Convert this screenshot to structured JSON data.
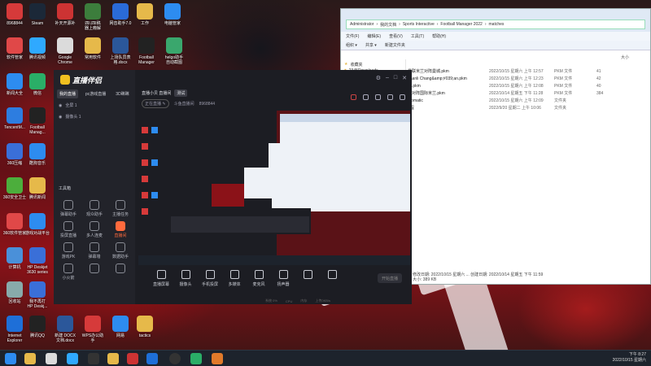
{
  "desktop": {
    "icons": [
      {
        "label": "8968844",
        "color": "#d63a3a"
      },
      {
        "label": "Steam",
        "color": "#1b2838"
      },
      {
        "label": "补天开源补",
        "color": "#c33"
      },
      {
        "label": "四I.四I稿\n器上瘾解",
        "color": "#3c7d3c"
      },
      {
        "label": "网音助手7.0",
        "color": "#2a6bd8"
      },
      {
        "label": "工作",
        "color": "#e6b94a"
      },
      {
        "label": "电脑管家",
        "color": "#2d8cf0"
      },
      {
        "label": "软件管家",
        "color": "#e04848"
      },
      {
        "label": "腾讯视频",
        "color": "#2fa9ff"
      },
      {
        "label": "Google\nChrome",
        "color": "#dbdbdb"
      },
      {
        "label": "常用软件",
        "color": "#e6b94a"
      },
      {
        "label": "上场队员表\n格.docx",
        "color": "#2b579a"
      },
      {
        "label": "Football\nManager",
        "color": "#222"
      },
      {
        "label": "helgo助手\n自动截图",
        "color": "#3aa76d"
      },
      {
        "label": "新闻大全",
        "color": "#2d8cf0"
      },
      {
        "label": "微信",
        "color": "#2aae67"
      },
      {
        "label": "TencentM...",
        "color": "#2d7de0"
      },
      {
        "label": "Football\nManag...",
        "color": "#222"
      },
      {
        "label": "360压缩",
        "color": "#3a6fd8"
      },
      {
        "label": "酷狗音乐",
        "color": "#2d8cf0"
      },
      {
        "label": "360安全卫士",
        "color": "#4cae3c"
      },
      {
        "label": "腾讯新闻",
        "color": "#e6b94a"
      },
      {
        "label": "360软件管家",
        "color": "#e04848"
      },
      {
        "label": "游戏对战平台",
        "color": "#2d8cf0"
      },
      {
        "label": "计算机",
        "color": "#4a90d9"
      },
      {
        "label": "HP Deskjet\n3630 series",
        "color": "#3a6fd8"
      },
      {
        "label": "回收站",
        "color": "#8aa"
      },
      {
        "label": "我不再打\nHP Deskj...",
        "color": "#3a6fd8"
      },
      {
        "label": "Internet\nExplorer",
        "color": "#1e6fd8"
      },
      {
        "label": "腾讯QQ",
        "color": "#222"
      },
      {
        "label": "新建 DOCX\n文档.docx",
        "color": "#2b579a"
      },
      {
        "label": "WPS办公助\n手",
        "color": "#d63a3a"
      },
      {
        "label": "网易",
        "color": "#2d8cf0"
      },
      {
        "label": "tactics",
        "color": "#e6b94a"
      }
    ]
  },
  "explorer": {
    "path": [
      "Administrator",
      "我的文档",
      "Sports Interactive",
      "Football Manager 2022",
      "matches"
    ],
    "menu": [
      "文件(F)",
      "编辑(E)",
      "查看(V)",
      "工具(T)",
      "帮助(H)"
    ],
    "toolbar": [
      "组织 ▾",
      "共享 ▾",
      "新建文件夹"
    ],
    "sidebar": [
      "收藏夹",
      "2345Downloads"
    ],
    "col_size": "大小",
    "rows": [
      {
        "name": "曼联米兰对阵曼城.pkm",
        "date": "2022/10/15 星期六 上午 12:57",
        "type": "PKM 文件",
        "size": "41"
      },
      {
        "name": "haanli Chang&amp;#039;an.pkm",
        "date": "2022/10/15 星期六 上午 12:23",
        "type": "PKM 文件",
        "size": "42"
      },
      {
        "name": "赛.pkm",
        "date": "2022/10/15 星期六 上午 12:08",
        "type": "PKM 文件",
        "size": "40"
      },
      {
        "name": "鹰对阵国际米兰.pkm",
        "date": "2022/10/14 星期五 下午 11:28",
        "type": "PKM 文件",
        "size": "384"
      },
      {
        "name": "utomatic",
        "date": "2022/10/15 星期六 上午 12:09",
        "type": "文件夹",
        "size": ""
      },
      {
        "name": "2程",
        "date": "2022/9/20 星期二 上午 10:06",
        "type": "文件夹",
        "size": ""
      }
    ],
    "status_line1": "修改日期: 2022/10/15 星期六 ... 创建日期: 2022/10/14 星期五 下午 11:59",
    "status_line2": "大小: 389 KB"
  },
  "app": {
    "brand": "直播伴侣",
    "tabs": [
      "我的直播",
      "pc游戏直播",
      "3D眯眯"
    ],
    "scene_name": "全屏 1",
    "scene_sub": "摄像头 1",
    "tools_title": "工具箱",
    "tools": [
      "弹幕助手",
      "观众助手",
      "主播任务",
      "投屏直播",
      "多人连麦",
      "直播间",
      "游戏PK",
      "弹幕墙",
      "数据助手",
      "小火箭",
      "",
      ""
    ],
    "active_tool": "直播间",
    "room_title": "直播小贝 直播间",
    "room_tag": "测试",
    "meta": [
      "正在直播 ✎",
      "斗鱼直播间",
      "8968844"
    ],
    "bottom_buttons": [
      "直播屏幕",
      "摄像头",
      "手机投屏",
      "多媒体",
      "麦克风",
      "扬声器",
      "",
      ""
    ],
    "start_label": "开始直播",
    "status": [
      "系统 0%",
      "CPU",
      "内存",
      "上传0KB/s"
    ]
  },
  "taskbar": {
    "clock": "下午 8:27",
    "date": "2022/10/15 星期六"
  }
}
